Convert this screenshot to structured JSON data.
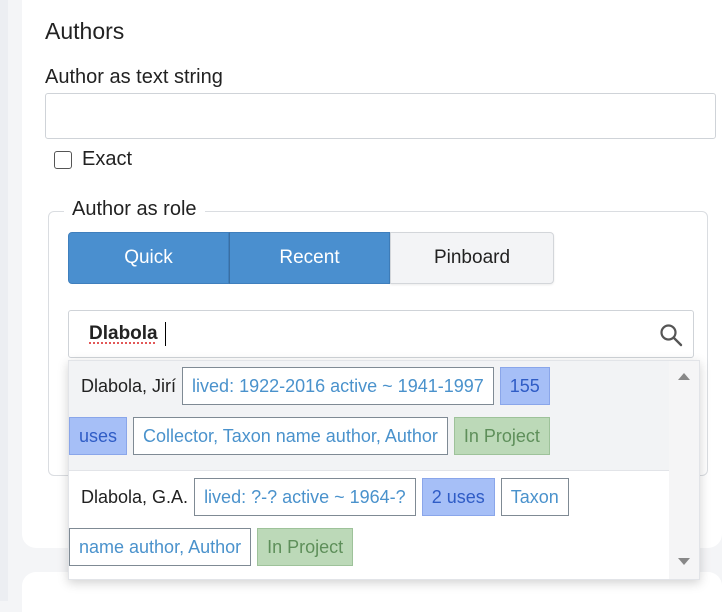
{
  "section_title": "Authors",
  "text_string": {
    "label": "Author as text string",
    "value": ""
  },
  "exact": {
    "label": "Exact",
    "checked": false
  },
  "role": {
    "legend": "Author as role",
    "tabs": [
      {
        "label": "Quick",
        "active": true
      },
      {
        "label": "Recent",
        "active": true
      },
      {
        "label": "Pinboard",
        "active": false
      }
    ],
    "search_value": "Dlabola"
  },
  "results": [
    {
      "name": "Dlabola, Jirí",
      "lived": "lived: 1922-2016 active ~ 1941-1997",
      "uses_part1": "155",
      "uses_part2": "uses",
      "roles": "Collector, Taxon name author, Author",
      "status": "In Project"
    },
    {
      "name": "Dlabola, G.A.",
      "lived": "lived: ?-? active ~ 1964-?",
      "uses": "2 uses",
      "roles_part1": "Taxon",
      "roles_part2": "name author, Author",
      "status": "In Project"
    }
  ],
  "colors": {
    "tab_active": "#4a8fcf",
    "uses_chip": "#a6bff7",
    "project_chip": "#bcd9b8",
    "info_text": "#4a92cc"
  },
  "icons": [
    "search-icon",
    "scroll-up-arrow-icon",
    "scroll-down-arrow-icon"
  ]
}
